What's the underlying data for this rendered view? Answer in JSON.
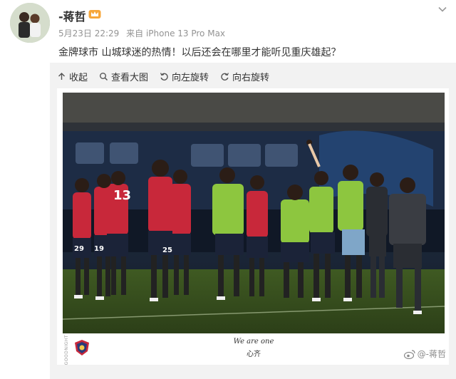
{
  "post": {
    "username": "-蒋哲",
    "badge_icon": "vip-crown-icon",
    "timestamp": "5月23日 22:29",
    "source": "来自 iPhone 13 Pro Max",
    "text": "金牌球市 山城球迷的热情！以后还会在哪里才能听见重庆雄起？"
  },
  "toolbar": {
    "items": [
      {
        "label": "收起",
        "icon": "collapse-up-icon"
      },
      {
        "label": "查看大图",
        "icon": "search-icon"
      },
      {
        "label": "向左旋转",
        "icon": "rotate-left-icon"
      },
      {
        "label": "向右旋转",
        "icon": "rotate-right-icon"
      }
    ]
  },
  "photo": {
    "slogan": "We are one",
    "slogan_cn": "心齐",
    "side_credit": "GOODNIGHT",
    "jersey_numbers": [
      "13",
      "19",
      "25",
      "29"
    ]
  },
  "watermark": "@-蒋哲",
  "colors": {
    "link": "#eb7350",
    "meta": "#939393",
    "red_kit": "#c8283a",
    "bib_green": "#8dc63f"
  }
}
